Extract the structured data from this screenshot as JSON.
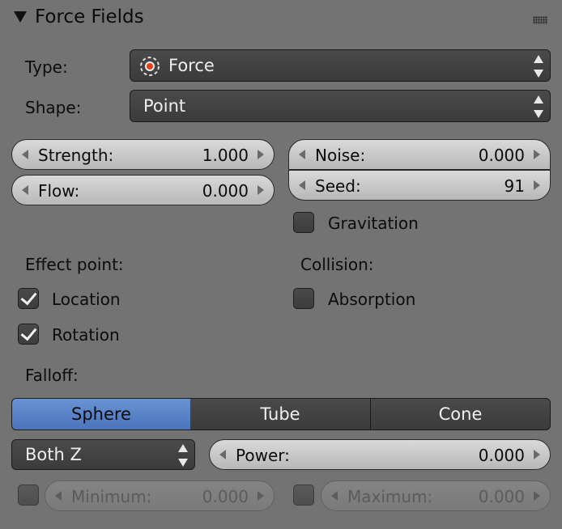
{
  "panel": {
    "title": "Force Fields"
  },
  "type_row": {
    "label": "Type:",
    "value": "Force",
    "icon": "force-field-icon"
  },
  "shape_row": {
    "label": "Shape:",
    "value": "Point"
  },
  "left_fields": [
    {
      "label": "Strength:",
      "value": "1.000"
    },
    {
      "label": "Flow:",
      "value": "0.000"
    }
  ],
  "right_fields": [
    {
      "label": "Noise:",
      "value": "0.000"
    },
    {
      "label": "Seed:",
      "value": "91"
    }
  ],
  "gravitation": {
    "label": "Gravitation",
    "checked": false
  },
  "effect_point": {
    "heading": "Effect point:",
    "location": {
      "label": "Location",
      "checked": true
    },
    "rotation": {
      "label": "Rotation",
      "checked": true
    }
  },
  "collision": {
    "heading": "Collision:",
    "absorption": {
      "label": "Absorption",
      "checked": false
    }
  },
  "falloff": {
    "heading": "Falloff:",
    "options": [
      "Sphere",
      "Tube",
      "Cone"
    ],
    "selected": "Sphere"
  },
  "falloff_axis": {
    "value": "Both Z"
  },
  "power": {
    "label": "Power:",
    "value": "0.000"
  },
  "minimum": {
    "label": "Minimum:",
    "value": "0.000",
    "enabled": false
  },
  "maximum": {
    "label": "Maximum:",
    "value": "0.000",
    "enabled": false
  },
  "colors": {
    "selected_accent": "#5b84c8",
    "panel_bg": "#737373"
  }
}
